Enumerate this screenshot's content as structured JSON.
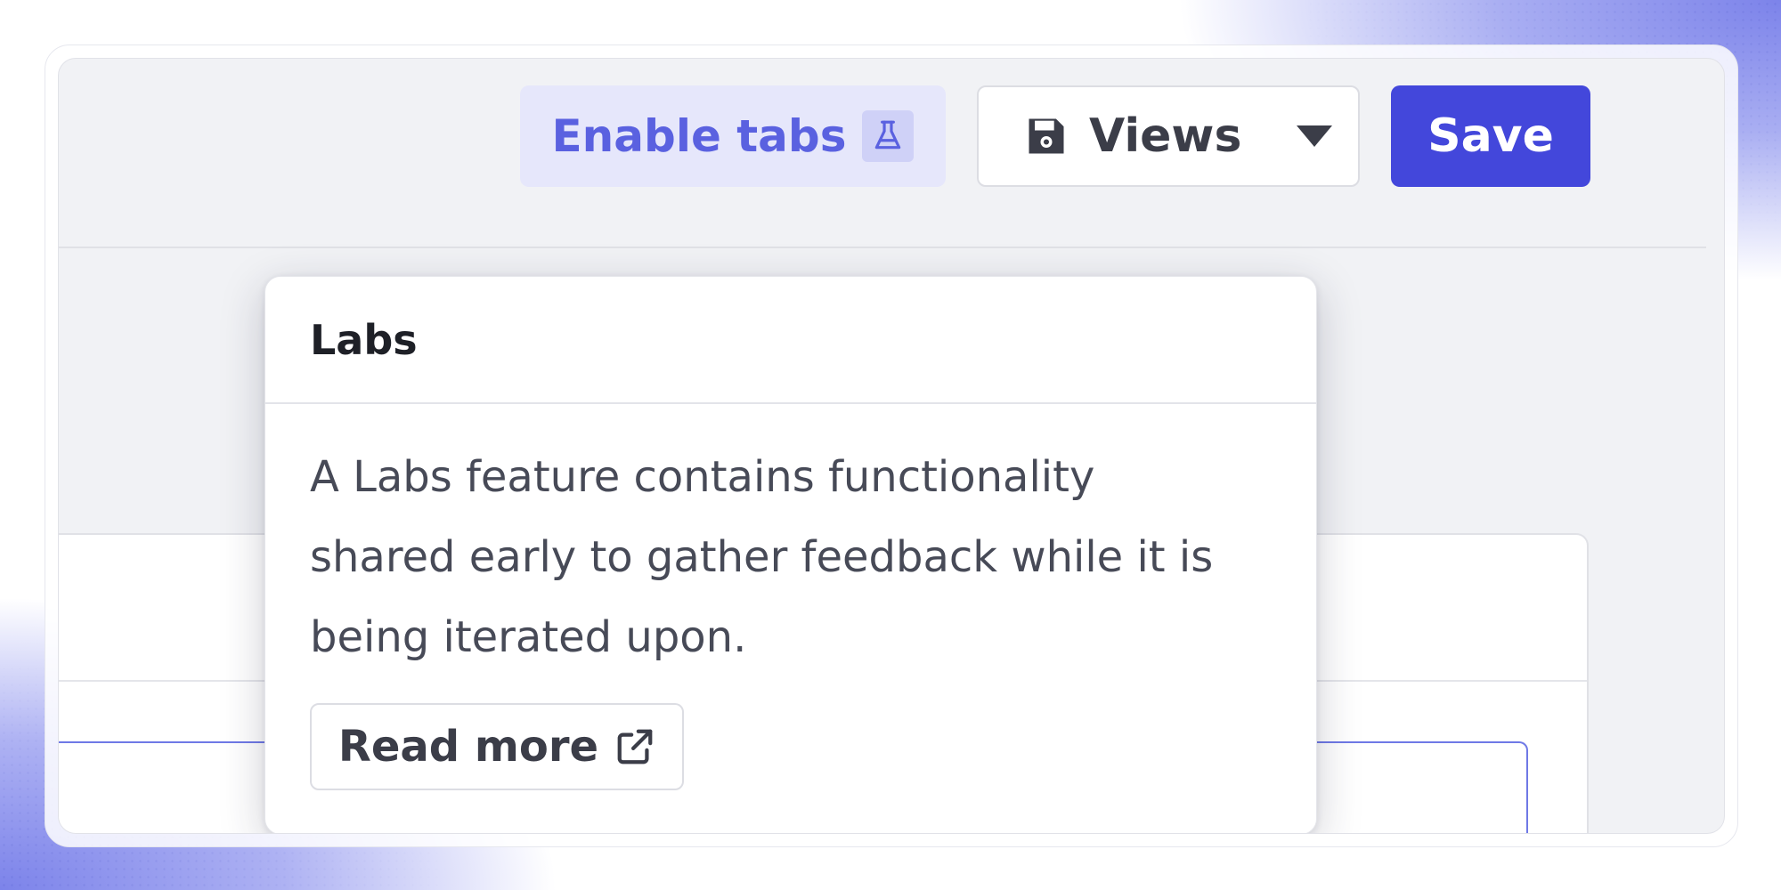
{
  "toolbar": {
    "enable_tabs_label": "Enable tabs",
    "enable_tabs_icon": "flask-icon",
    "views_label": "Views",
    "views_icon": "save-icon",
    "views_dropdown_icon": "caret-down-icon",
    "save_label": "Save"
  },
  "popover": {
    "title": "Labs",
    "body": "A Labs feature contains functionality\nshared early to gather feedback while it is\nbeing iterated upon.",
    "read_more_label": "Read more",
    "read_more_icon": "external-link-icon"
  },
  "colors": {
    "accent": "#4347db",
    "labs_text": "#5a61e0",
    "labs_bg": "#e6e7fb"
  }
}
